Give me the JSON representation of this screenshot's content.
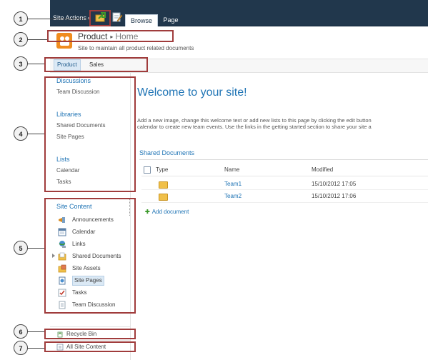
{
  "ribbon": {
    "site_actions": "Site Actions",
    "site_actions_arrow": "▾",
    "tabs": [
      {
        "label": "Browse",
        "selected": true
      },
      {
        "label": "Page",
        "selected": false
      }
    ],
    "icons": [
      "navigate-up-icon",
      "edit-page-icon"
    ]
  },
  "header": {
    "site_title": "Product",
    "breadcrumb_separator": "▸",
    "current_page": "Home",
    "description": "Site to maintain all product related documents"
  },
  "top_nav": {
    "items": [
      {
        "label": "Product",
        "selected": true
      },
      {
        "label": "Sales",
        "selected": false
      }
    ]
  },
  "left_nav": {
    "sections": [
      {
        "heading": "Discussions",
        "links": [
          "Team Discussion"
        ]
      },
      {
        "heading": "Libraries",
        "links": [
          "Shared Documents",
          "Site Pages"
        ]
      },
      {
        "heading": "Lists",
        "links": [
          "Calendar",
          "Tasks"
        ]
      }
    ],
    "site_content": {
      "heading": "Site Content",
      "items": [
        {
          "label": "Announcements",
          "icon": "announcements-icon",
          "selected": false
        },
        {
          "label": "Calendar",
          "icon": "calendar-icon",
          "selected": false
        },
        {
          "label": "Links",
          "icon": "links-icon",
          "selected": false
        },
        {
          "label": "Shared Documents",
          "icon": "document-library-icon",
          "selected": false,
          "expandable": true
        },
        {
          "label": "Site Assets",
          "icon": "site-assets-icon",
          "selected": false
        },
        {
          "label": "Site Pages",
          "icon": "site-pages-icon",
          "selected": true
        },
        {
          "label": "Tasks",
          "icon": "tasks-icon",
          "selected": false
        },
        {
          "label": "Team Discussion",
          "icon": "discussion-icon",
          "selected": false
        }
      ]
    },
    "recycle_bin": "Recycle Bin",
    "all_site_content": "All Site Content"
  },
  "main": {
    "welcome_title": "Welcome to your site!",
    "welcome_text_line1": "Add a new image, change this welcome text or add new lists to this page by clicking the edit button",
    "welcome_text_line2": "calendar to create new team events. Use the links in the getting started section to share your site a",
    "documents": {
      "title": "Shared Documents",
      "columns": [
        "Type",
        "Name",
        "Modified"
      ],
      "rows": [
        {
          "type": "folder-icon",
          "name": "Team1",
          "modified": "15/10/2012 17:05"
        },
        {
          "type": "folder-icon",
          "name": "Team2",
          "modified": "15/10/2012 17:06"
        }
      ],
      "add_document": "Add document",
      "add_icon": "plus-icon"
    }
  },
  "callouts": [
    "1",
    "2",
    "3",
    "4",
    "5",
    "6",
    "7"
  ],
  "colors": {
    "ribbon": "#21374c",
    "link": "#1f74b5",
    "callout_box": "#a03c3c",
    "selected_bg": "#dbe9f5"
  }
}
